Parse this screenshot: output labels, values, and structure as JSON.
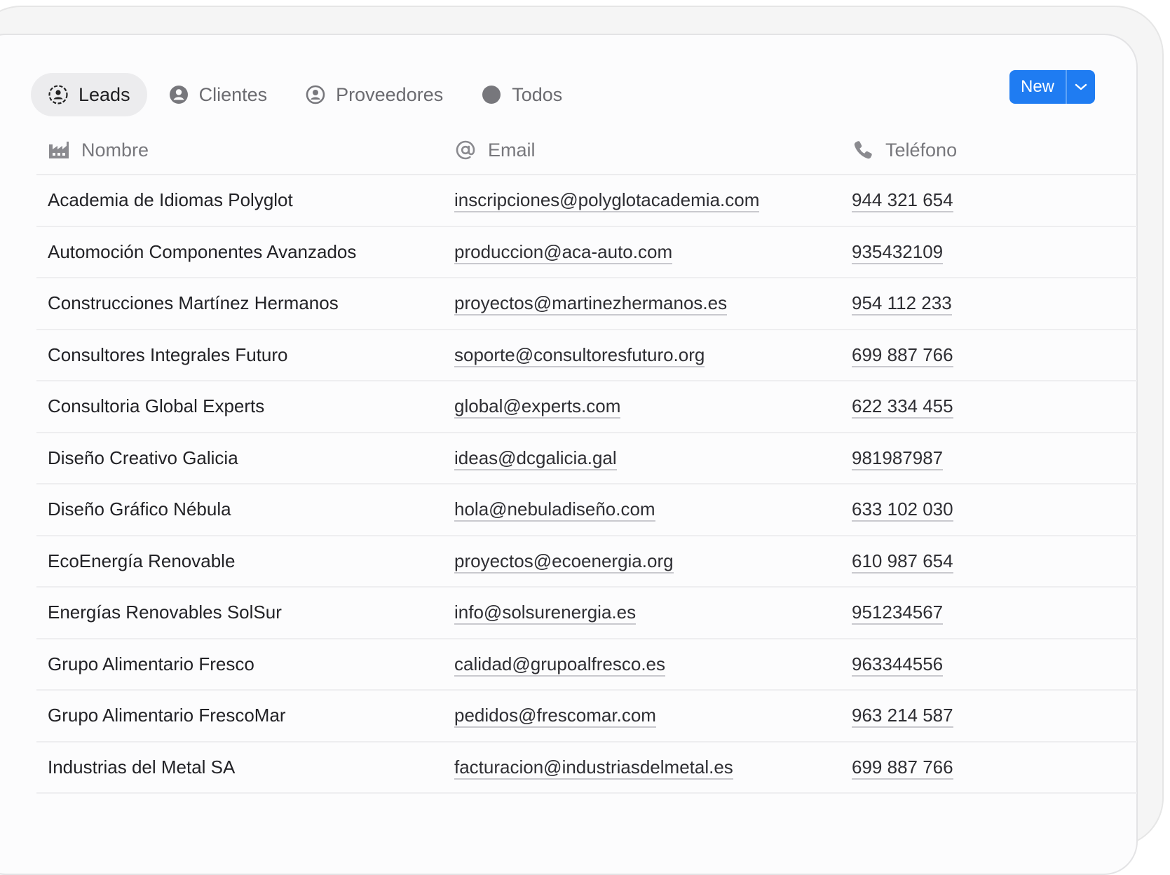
{
  "tabs": [
    {
      "label": "Leads",
      "icon": "leads-icon",
      "active": true
    },
    {
      "label": "Clientes",
      "icon": "user-icon",
      "active": false
    },
    {
      "label": "Proveedores",
      "icon": "user-circle-icon",
      "active": false
    },
    {
      "label": "Todos",
      "icon": "dot-icon",
      "active": false
    }
  ],
  "toolbar": {
    "new_label": "New"
  },
  "table": {
    "columns": [
      {
        "label": "Nombre",
        "icon": "factory-icon"
      },
      {
        "label": "Email",
        "icon": "at-icon"
      },
      {
        "label": "Teléfono",
        "icon": "phone-icon"
      }
    ],
    "rows": [
      {
        "name": "Academia de Idiomas Polyglot",
        "email": "inscripciones@polyglotacademia.com",
        "phone": "944 321 654"
      },
      {
        "name": "Automoción Componentes Avanzados",
        "email": "produccion@aca-auto.com",
        "phone": "935432109"
      },
      {
        "name": "Construcciones Martínez Hermanos",
        "email": "proyectos@martinezhermanos.es",
        "phone": "954 112 233"
      },
      {
        "name": "Consultores Integrales Futuro",
        "email": "soporte@consultoresfuturo.org",
        "phone": "699 887 766"
      },
      {
        "name": "Consultoria Global Experts",
        "email": "global@experts.com",
        "phone": "622 334 455"
      },
      {
        "name": "Diseño Creativo Galicia",
        "email": "ideas@dcgalicia.gal",
        "phone": "981987987"
      },
      {
        "name": "Diseño Gráfico Nébula",
        "email": "hola@nebuladiseño.com",
        "phone": "633 102 030"
      },
      {
        "name": "EcoEnergía Renovable",
        "email": "proyectos@ecoenergia.org",
        "phone": "610 987 654"
      },
      {
        "name": "Energías Renovables SolSur",
        "email": "info@solsurenergia.es",
        "phone": "951234567"
      },
      {
        "name": "Grupo Alimentario Fresco",
        "email": "calidad@grupoalfresco.es",
        "phone": "963344556"
      },
      {
        "name": "Grupo Alimentario FrescoMar",
        "email": "pedidos@frescomar.com",
        "phone": "963 214 587"
      },
      {
        "name": "Industrias del Metal SA",
        "email": "facturacion@industriasdelmetal.es",
        "phone": "699 887 766"
      }
    ]
  },
  "colors": {
    "accent": "#1f7cf2",
    "active_tab_bg": "#ececee"
  }
}
